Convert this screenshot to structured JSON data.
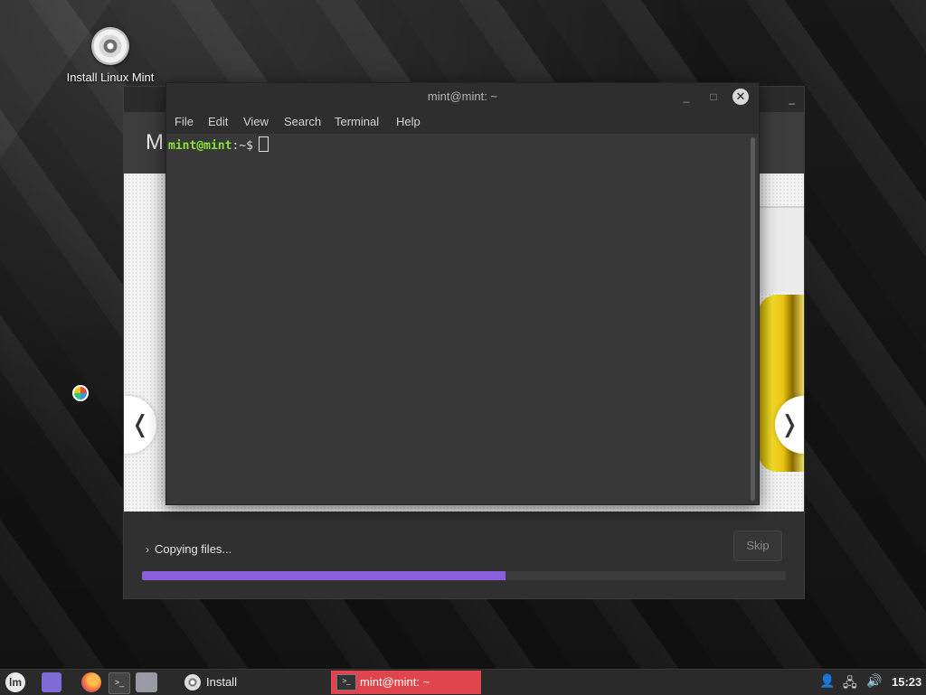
{
  "desktop": {
    "icons": [
      {
        "label": "Install Linux Mint",
        "icon": "disc-icon"
      }
    ]
  },
  "installer": {
    "header_letter": "M",
    "slide_prev": "❬",
    "slide_next": "❭",
    "status": {
      "chevron": "›",
      "text": "Copying files..."
    },
    "skip_label": "Skip",
    "progress": {
      "fraction": 0.564,
      "color": "#8b5fdc"
    }
  },
  "terminal": {
    "title": "mint@mint: ~",
    "controls": {
      "minimize": "_",
      "maximize": "□",
      "close": "✕"
    },
    "menu": [
      "File",
      "Edit",
      "View",
      "Search",
      "Terminal",
      "Help"
    ],
    "prompt": {
      "user_host": "mint@mint",
      "path": ":~$"
    },
    "colors": {
      "prompt_user": "#8ae234"
    }
  },
  "taskbar": {
    "menu_icon": "lm",
    "launchers": [
      "show-desktop-icon",
      "firefox-icon",
      "terminal-icon",
      "files-icon"
    ],
    "tasks": [
      {
        "label": "Install",
        "icon": "disc-icon",
        "active": false
      },
      {
        "label": "mint@mint: ~",
        "icon": "terminal-icon",
        "active": true
      }
    ],
    "term_launcher_glyph": ">_",
    "tray": {
      "user": "👤",
      "network": "🖧",
      "volume": "🔊"
    },
    "clock": "15:23",
    "active_color": "#e0454d"
  }
}
